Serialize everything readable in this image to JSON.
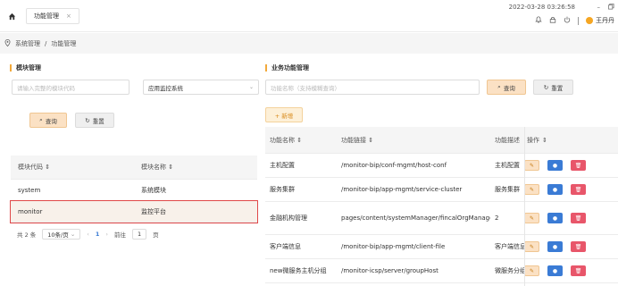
{
  "topbar": {
    "tab_label": "功能管理",
    "tab_close": "×",
    "datetime": "2022-03-28 03:26:58",
    "user_name": "王丹丹"
  },
  "breadcrumb": {
    "items": [
      "系统管理",
      "/",
      "功能管理"
    ]
  },
  "left": {
    "title": "模块管理",
    "code_placeholder": "请输入完整的模块代码",
    "system_select": "应用监控系统",
    "query_label": "查询",
    "reset_label": "重置",
    "columns": [
      "模块代码",
      "模块名称"
    ],
    "rows": [
      {
        "code": "system",
        "name": "系统模块"
      },
      {
        "code": "monitor",
        "name": "监控平台"
      }
    ],
    "pager": {
      "total": "共 2 条",
      "page_size": "10条/页",
      "current": "1",
      "goto": "前往",
      "goto_value": "1",
      "page_unit": "页"
    }
  },
  "right": {
    "title": "业务功能管理",
    "name_placeholder": "功能名称（支持模糊查询）",
    "query_label": "查询",
    "reset_label": "重置",
    "add_label": "+ 新增",
    "columns": [
      "功能名称",
      "功能链接",
      "功能描述",
      "操作"
    ],
    "rows": [
      {
        "name": "主机配置",
        "link": "/monitor-bip/conf-mgmt/host-conf",
        "desc": "主机配置"
      },
      {
        "name": "服务集群",
        "link": "/monitor-bip/app-mgmt/service-cluster",
        "desc": "服务集群"
      },
      {
        "name": "金融机构管理",
        "link": "pages/content/systemManager/fincalOrgManager/fincalOrgManager",
        "desc": "2"
      },
      {
        "name": "客户端信息",
        "link": "/monitor-bip/app-mgmt/client-file",
        "desc": "客户端信息"
      },
      {
        "name": "new微服务主机分组",
        "link": "/monitor-icsp/server/groupHost",
        "desc": "微服务分组"
      }
    ]
  },
  "colors": {
    "accent": "#f2a93b",
    "info_button": "#3a7bd5",
    "delete_button": "#e8566a",
    "selected_outline": "#e04848"
  }
}
